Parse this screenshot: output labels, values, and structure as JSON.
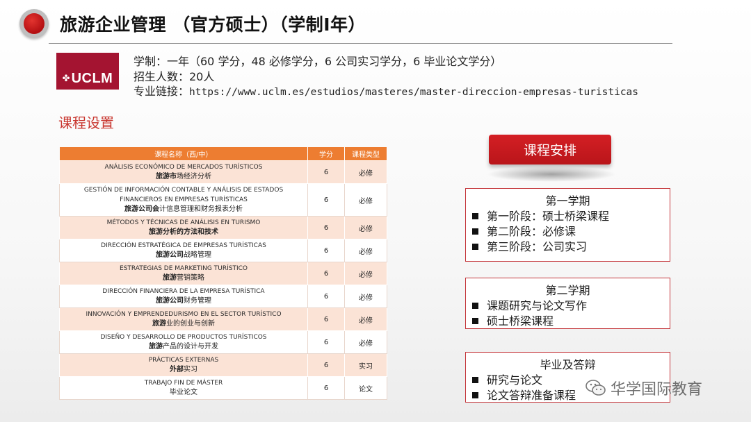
{
  "header": {
    "title": "旅游企业管理 （官方硕士）（学制Ⅰ年）"
  },
  "logo": {
    "text": "UCLM"
  },
  "info": {
    "duration": "学制：一年（60 学分，48 必修学分，6 公司实习学分，6 毕业论文学分）",
    "enrollment": "招生人数：20人",
    "link_label": "专业链接：",
    "link_url": "https://www.uclm.es/estudios/masteres/master-direccion-empresas-turisticas"
  },
  "courses": {
    "section_title": "课程设置",
    "headers": [
      "课程名称（西/中）",
      "学分",
      "课程类型"
    ],
    "rows": [
      {
        "es": [
          "ANÁLISIS ECONÓMICO DE MERCADOS TURÍSTICOS"
        ],
        "zh_bold": "旅游市",
        "zh": "场经济分析",
        "credits": "6",
        "type": "必修"
      },
      {
        "es": [
          "GESTIÓN DE INFORMACIÓN CONTABLE Y ANÁLISIS DE ESTADOS",
          "FINANCIEROS EN EMPRESAS TURÍSTICAS"
        ],
        "zh_bold": "旅游公司会",
        "zh": "计信息管理和财务报表分析",
        "credits": "6",
        "type": "必修"
      },
      {
        "es": [
          "MÉTODOS Y TÉCNICAS DE ANÁLISIS EN TURISMO"
        ],
        "zh_bold": "旅游分析的方法和技术",
        "zh": "",
        "credits": "6",
        "type": "必修"
      },
      {
        "es": [
          "DIRECCIÓN ESTRATÉGICA DE EMPRESAS TURÍSTICAS"
        ],
        "zh_bold": "旅游公司",
        "zh": "战略管理",
        "credits": "6",
        "type": "必修"
      },
      {
        "es": [
          "ESTRATEGIAS DE MARKETING TURÍSTICO"
        ],
        "zh_bold": "旅游",
        "zh": "营销策略",
        "credits": "6",
        "type": "必修"
      },
      {
        "es": [
          "DIRECCIÓN FINANCIERA DE LA EMPRESA TURÍSTICA"
        ],
        "zh_bold": "旅游公司",
        "zh": "财务管理",
        "credits": "6",
        "type": "必修"
      },
      {
        "es": [
          "INNOVACIÓN Y EMPRENDEDURISMO EN EL SECTOR TURÍSTICO"
        ],
        "zh_bold": "旅游",
        "zh": "业的创业与创新",
        "credits": "6",
        "type": "必修"
      },
      {
        "es": [
          "DISEÑO Y DESARROLLO DE PRODUCTOS TURÍSTICOS"
        ],
        "zh_bold": "旅游",
        "zh": "产品的设计与开发",
        "credits": "6",
        "type": "必修"
      },
      {
        "es": [
          "PRÁCTICAS EXTERNAS"
        ],
        "zh_bold": "外部",
        "zh": "实习",
        "credits": "6",
        "type": "实习"
      },
      {
        "es": [
          "TRABAJO FIN DE MÁSTER"
        ],
        "zh_bold": "",
        "zh": "毕业论文",
        "credits": "6",
        "type": "论文"
      }
    ]
  },
  "schedule": {
    "button_label": "课程安排",
    "blocks": [
      {
        "title": "第一学期",
        "items": [
          "第一阶段：硕士桥梁课程",
          "第二阶段：必修课",
          "第三阶段：公司实习"
        ]
      },
      {
        "title": "第二学期",
        "items": [
          "课题研究与论文写作",
          "硕士桥梁课程"
        ]
      },
      {
        "title": "毕业及答辩",
        "items": [
          "研究与论文",
          "论文答辩准备课程"
        ]
      }
    ]
  },
  "watermark": {
    "text": "华学国际教育",
    "icon": "wechat-icon"
  },
  "colors": {
    "accent_red": "#c8352e",
    "table_header": "#ed7d31",
    "table_band": "#fbe3d6",
    "logo_bg": "#a41431"
  }
}
